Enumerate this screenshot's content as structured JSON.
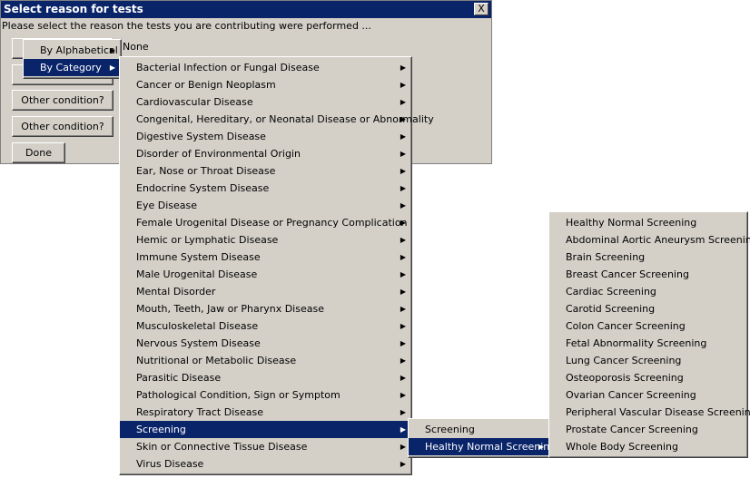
{
  "dialog": {
    "title": "Select reason for tests",
    "close_label": "X",
    "prompt": "Please select the reason the tests you are contributing were performed ...",
    "condition_value": "None",
    "buttons": {
      "other1": "Other condition?",
      "other2": "Other condition?",
      "done": "Done"
    }
  },
  "arrow_glyph": "▶",
  "menu_level1": {
    "items": [
      {
        "label": "By Alphabetical",
        "selected": false
      },
      {
        "label": "By Category",
        "selected": true
      }
    ]
  },
  "menu_level2": {
    "items": [
      {
        "label": "Bacterial Infection or Fungal Disease"
      },
      {
        "label": "Cancer or Benign Neoplasm"
      },
      {
        "label": "Cardiovascular Disease"
      },
      {
        "label": "Congenital, Hereditary, or Neonatal Disease or Abnormality"
      },
      {
        "label": "Digestive System Disease"
      },
      {
        "label": "Disorder of Environmental Origin"
      },
      {
        "label": "Ear, Nose or Throat Disease"
      },
      {
        "label": "Endocrine System Disease"
      },
      {
        "label": "Eye Disease"
      },
      {
        "label": "Female Urogenital Disease or Pregnancy Complication"
      },
      {
        "label": "Hemic or Lymphatic Disease"
      },
      {
        "label": "Immune System Disease"
      },
      {
        "label": "Male Urogenital Disease"
      },
      {
        "label": "Mental Disorder"
      },
      {
        "label": "Mouth, Teeth, Jaw or Pharynx Disease"
      },
      {
        "label": "Musculoskeletal Disease"
      },
      {
        "label": "Nervous System Disease"
      },
      {
        "label": "Nutritional or Metabolic Disease"
      },
      {
        "label": "Parasitic Disease"
      },
      {
        "label": "Pathological Condition, Sign or Symptom"
      },
      {
        "label": "Respiratory Tract Disease"
      },
      {
        "label": "Screening",
        "selected": true
      },
      {
        "label": "Skin or Connective Tissue Disease"
      },
      {
        "label": "Virus Disease"
      }
    ]
  },
  "menu_level3": {
    "items": [
      {
        "label": "Screening",
        "submenu": false
      },
      {
        "label": "Healthy Normal Screening",
        "submenu": true,
        "selected": true
      }
    ]
  },
  "menu_level4": {
    "items": [
      {
        "label": "Healthy Normal Screening"
      },
      {
        "label": "Abdominal Aortic Aneurysm Screening"
      },
      {
        "label": "Brain Screening"
      },
      {
        "label": "Breast Cancer Screening"
      },
      {
        "label": "Cardiac Screening"
      },
      {
        "label": "Carotid Screening"
      },
      {
        "label": "Colon Cancer Screening"
      },
      {
        "label": "Fetal Abnormality Screening"
      },
      {
        "label": "Lung Cancer Screening"
      },
      {
        "label": "Osteoporosis Screening"
      },
      {
        "label": "Ovarian Cancer Screening"
      },
      {
        "label": "Peripheral Vascular Disease Screening"
      },
      {
        "label": "Prostate Cancer Screening"
      },
      {
        "label": "Whole Body Screening"
      }
    ]
  },
  "colors": {
    "selection_bg": "#0a246a",
    "window_bg": "#d4d0c8"
  }
}
